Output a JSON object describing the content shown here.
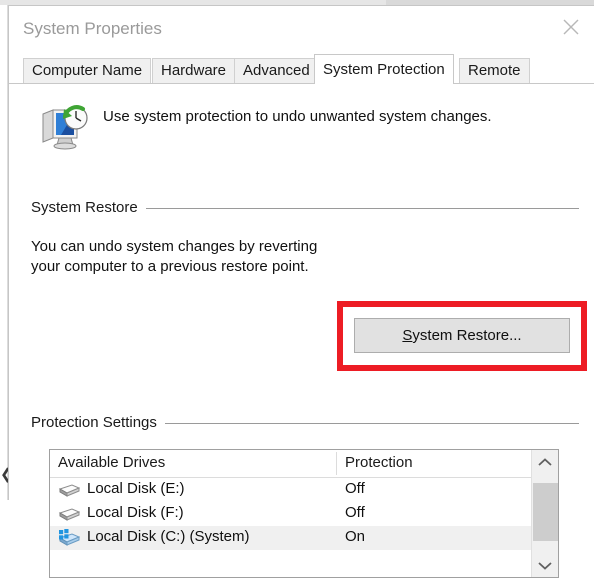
{
  "window": {
    "title": "System Properties",
    "close_icon": "close-x-icon"
  },
  "tabs": [
    {
      "label": "Computer Name",
      "selected": false
    },
    {
      "label": "Hardware",
      "selected": false
    },
    {
      "label": "Advanced",
      "selected": false
    },
    {
      "label": "System Protection",
      "selected": true
    },
    {
      "label": "Remote",
      "selected": false
    }
  ],
  "header": {
    "icon": "system-restore-icon",
    "description": "Use system protection to undo unwanted system changes."
  },
  "system_restore": {
    "group_label": "System Restore",
    "body_text": "You can undo system changes by reverting your computer to a previous restore point.",
    "button_accel": "S",
    "button_rest": "ystem Restore..."
  },
  "protection_settings": {
    "group_label": "Protection Settings",
    "columns": [
      "Available Drives",
      "Protection"
    ],
    "rows": [
      {
        "icon": "hard-disk-icon",
        "name": "Local Disk (E:)",
        "protection": "Off",
        "selected": false
      },
      {
        "icon": "hard-disk-icon",
        "name": "Local Disk (F:)",
        "protection": "Off",
        "selected": false
      },
      {
        "icon": "system-disk-icon",
        "name": "Local Disk (C:) (System)",
        "protection": "On",
        "selected": true
      }
    ],
    "scrollbar": {
      "up_icon": "chevron-up-icon",
      "down_icon": "chevron-down-icon"
    }
  },
  "annotation": {
    "highlight_color": "#ed1c24",
    "highlight_target": "System Restore..."
  },
  "desktop": {
    "back_arrow_icon": "back-arrow-icon"
  }
}
